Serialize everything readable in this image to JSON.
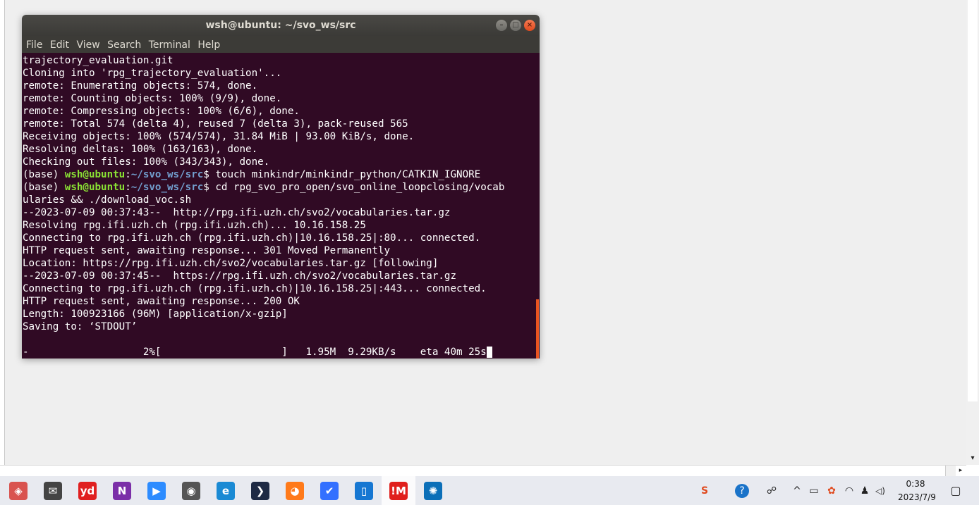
{
  "window": {
    "title": "wsh@ubuntu: ~/svo_ws/src",
    "minimize_glyph": "–",
    "maximize_glyph": "□",
    "close_glyph": "×"
  },
  "menu": [
    "File",
    "Edit",
    "View",
    "Search",
    "Terminal",
    "Help"
  ],
  "terminal": {
    "colors": {
      "background": "#300a24",
      "user": "#8ae234",
      "path": "#729fcf",
      "scroll": "#e95420"
    },
    "lines": [
      "trajectory_evaluation.git",
      "Cloning into 'rpg_trajectory_evaluation'...",
      "remote: Enumerating objects: 574, done.",
      "remote: Counting objects: 100% (9/9), done.",
      "remote: Compressing objects: 100% (6/6), done.",
      "remote: Total 574 (delta 4), reused 7 (delta 3), pack-reused 565",
      "Receiving objects: 100% (574/574), 31.84 MiB | 93.00 KiB/s, done.",
      "Resolving deltas: 100% (163/163), done.",
      "Checking out files: 100% (343/343), done."
    ],
    "prompt1": {
      "env": "(base) ",
      "user": "wsh@ubuntu",
      "colon": ":",
      "path": "~/svo_ws/src",
      "dollar": "$ ",
      "command": "touch minkindr/minkindr_python/CATKIN_IGNORE"
    },
    "prompt2": {
      "env": "(base) ",
      "user": "wsh@ubuntu",
      "colon": ":",
      "path": "~/svo_ws/src",
      "dollar": "$ ",
      "command": "cd rpg_svo_pro_open/svo_online_loopclosing/vocab"
    },
    "lines_after": [
      "ularies && ./download_voc.sh",
      "--2023-07-09 00:37:43--  http://rpg.ifi.uzh.ch/svo2/vocabularies.tar.gz",
      "Resolving rpg.ifi.uzh.ch (rpg.ifi.uzh.ch)... 10.16.158.25",
      "Connecting to rpg.ifi.uzh.ch (rpg.ifi.uzh.ch)|10.16.158.25|:80... connected.",
      "HTTP request sent, awaiting response... 301 Moved Permanently",
      "Location: https://rpg.ifi.uzh.ch/svo2/vocabularies.tar.gz [following]",
      "--2023-07-09 00:37:45--  https://rpg.ifi.uzh.ch/svo2/vocabularies.tar.gz",
      "Connecting to rpg.ifi.uzh.ch (rpg.ifi.uzh.ch)|10.16.158.25|:443... connected.",
      "HTTP request sent, awaiting response... 200 OK",
      "Length: 100923166 (96M) [application/x-gzip]",
      "Saving to: ‘STDOUT’",
      ""
    ],
    "progress_line": "-                   2%[                    ]   1.95M  9.29KB/s    eta 40m 25s"
  },
  "scrollbars": {
    "down_arrow": "▾",
    "right_arrow": "▸"
  },
  "taskbar": {
    "apps": [
      {
        "name": "start-icon",
        "glyph": "◈",
        "color": "#d9534f"
      },
      {
        "name": "mail-icon",
        "glyph": "✉",
        "color": "#444444"
      },
      {
        "name": "youdao-icon",
        "glyph": "yd",
        "color": "#e02020"
      },
      {
        "name": "onenote-icon",
        "glyph": "N",
        "color": "#7b2fa8"
      },
      {
        "name": "zoom-icon",
        "glyph": "▶",
        "color": "#2d8cff"
      },
      {
        "name": "camera-icon",
        "glyph": "◉",
        "color": "#555555"
      },
      {
        "name": "edge-icon",
        "glyph": "e",
        "color": "#1a8ad4"
      },
      {
        "name": "terminal-app-icon",
        "glyph": "❯",
        "color": "#1e2a44"
      },
      {
        "name": "firefox-icon",
        "glyph": "◕",
        "color": "#ff7a1a"
      },
      {
        "name": "feishu-icon",
        "glyph": "✔",
        "color": "#3370ff"
      },
      {
        "name": "tablet-icon",
        "glyph": "▯",
        "color": "#1677d2"
      },
      {
        "name": "vmware-icon",
        "glyph": "!M",
        "color": "#e0201d"
      },
      {
        "name": "media-icon",
        "glyph": "✺",
        "color": "#0b6fb8"
      }
    ],
    "tray": [
      {
        "name": "input-method-icon",
        "glyph": "S"
      },
      {
        "name": "help-icon",
        "glyph": "?"
      },
      {
        "name": "people-icon",
        "glyph": "☍"
      },
      {
        "name": "chevron-up-icon",
        "glyph": "^"
      },
      {
        "name": "battery-icon",
        "glyph": "▭"
      },
      {
        "name": "network-app-icon",
        "glyph": "✿"
      },
      {
        "name": "wifi-icon",
        "glyph": "◠"
      },
      {
        "name": "qq-icon",
        "glyph": "♟"
      },
      {
        "name": "volume-icon",
        "glyph": "◁)"
      },
      {
        "name": "notification-icon",
        "glyph": "▢"
      }
    ],
    "clock_time": "0:38",
    "clock_date": "2023/7/9"
  }
}
